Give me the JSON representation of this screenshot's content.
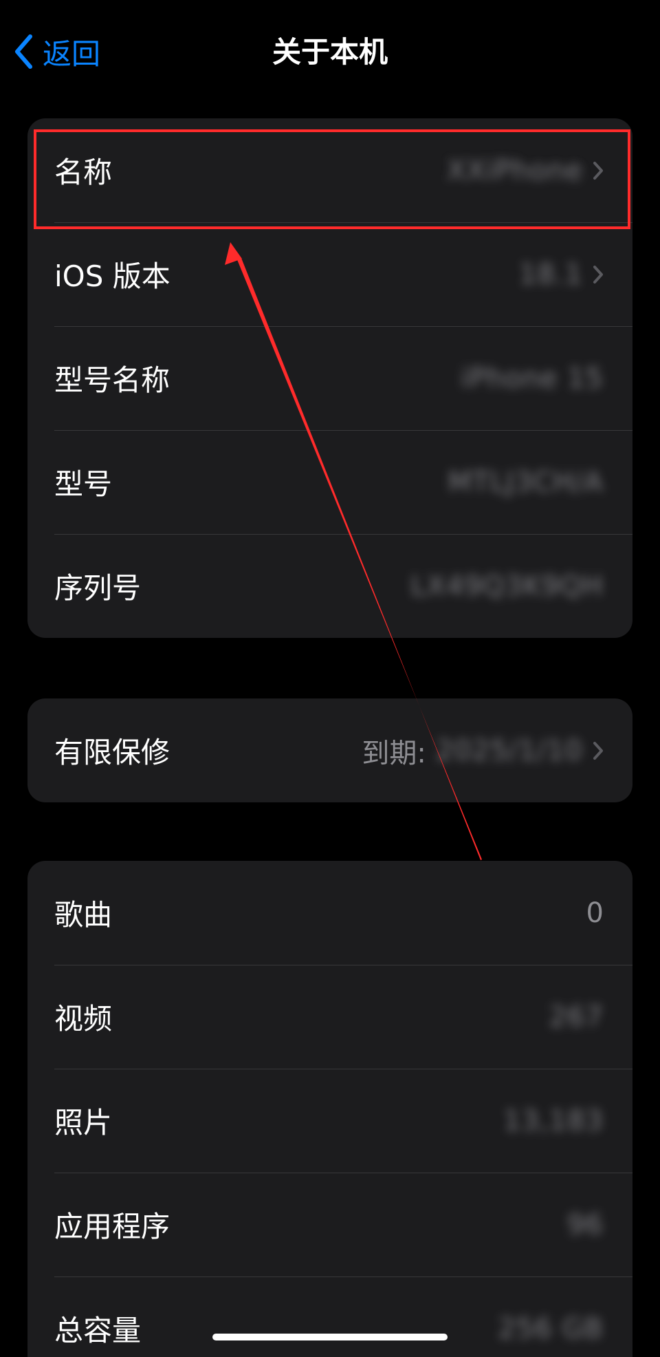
{
  "nav": {
    "back_label": "返回",
    "title": "关于本机"
  },
  "group1": {
    "rows": [
      {
        "label": "名称",
        "value": "XXiPhone",
        "chevron": true
      },
      {
        "label": "iOS 版本",
        "value": "18.1",
        "chevron": true
      },
      {
        "label": "型号名称",
        "value": "iPhone 15"
      },
      {
        "label": "型号",
        "value": "MTLJ3CH/A"
      },
      {
        "label": "序列号",
        "value": "LX49Q3K9QH"
      }
    ]
  },
  "group2": {
    "rows": [
      {
        "label": "有限保修",
        "value_prefix": "到期:",
        "value": "2025/1/10",
        "chevron": true
      }
    ]
  },
  "group3": {
    "rows": [
      {
        "label": "歌曲",
        "value": "0"
      },
      {
        "label": "视频",
        "value": "267"
      },
      {
        "label": "照片",
        "value": "13,183"
      },
      {
        "label": "应用程序",
        "value": "96"
      },
      {
        "label": "总容量",
        "value": "256 GB"
      }
    ]
  },
  "colors": {
    "background": "#000000",
    "group": "#1c1c1e",
    "accent": "#0a84ff",
    "annotation": "#ff2b2b"
  },
  "icons": {
    "back": "chevron-left-icon",
    "disclosure": "chevron-right-icon"
  }
}
